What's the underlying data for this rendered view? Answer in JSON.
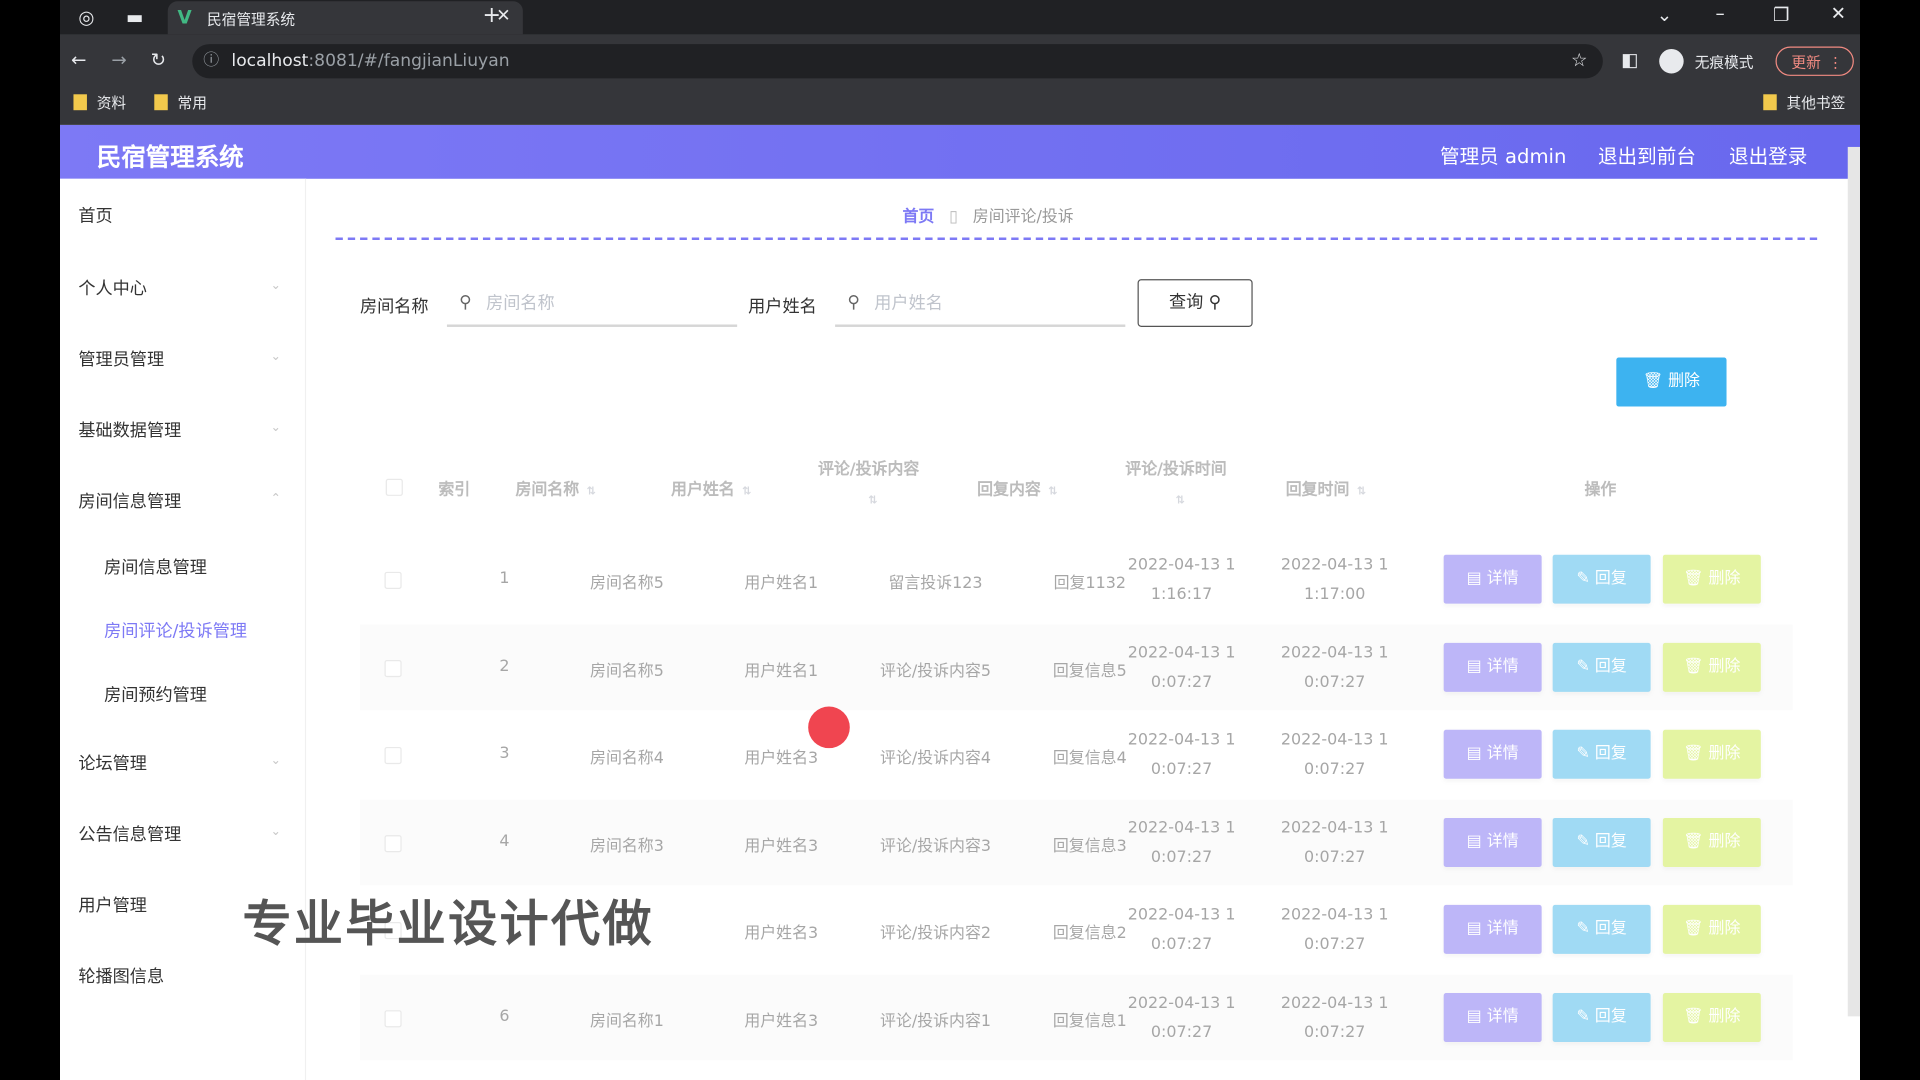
{
  "browser": {
    "tab_title": "民宿管理系统",
    "url_host": "localhost",
    "url_rest": ":8081/#/fangjianLiuyan",
    "profile_label": "无痕模式",
    "update_label": "更新",
    "bookmarks": [
      "资料",
      "常用"
    ],
    "other_bookmarks": "其他书签"
  },
  "header": {
    "title": "民宿管理系统",
    "admin_label": "管理员 admin",
    "to_front": "退出到前台",
    "logout": "退出登录"
  },
  "sidebar": {
    "items": [
      "首页",
      "个人中心",
      "管理员管理",
      "基础数据管理",
      "房间信息管理"
    ],
    "sub_items": [
      "房间信息管理",
      "房间评论/投诉管理",
      "房间预约管理"
    ],
    "items2": [
      "论坛管理",
      "公告信息管理",
      "用户管理",
      "轮播图信息"
    ]
  },
  "breadcrumb": {
    "home": "首页",
    "current": "房间评论/投诉"
  },
  "search": {
    "room_label": "房间名称",
    "room_placeholder": "房间名称",
    "user_label": "用户姓名",
    "user_placeholder": "用户姓名",
    "query_label": "查询"
  },
  "toolbar": {
    "delete_label": "删除"
  },
  "table": {
    "headers": [
      "索引",
      "房间名称",
      "用户姓名",
      "评论/投诉内容",
      "回复内容",
      "评论/投诉时间",
      "回复时间",
      "操作"
    ],
    "rows": [
      {
        "index": "1",
        "room": "房间名称5",
        "user": "用户姓名1",
        "content": "留言投诉123",
        "reply": "回复1132",
        "time1": "2022-04-13 1",
        "time2": "1:16:17",
        "rtime1": "2022-04-13 1",
        "rtime2": "1:17:00"
      },
      {
        "index": "2",
        "room": "房间名称5",
        "user": "用户姓名1",
        "content": "评论/投诉内容5",
        "reply": "回复信息5",
        "time1": "2022-04-13 1",
        "time2": "0:07:27",
        "rtime1": "2022-04-13 1",
        "rtime2": "0:07:27"
      },
      {
        "index": "3",
        "room": "房间名称4",
        "user": "用户姓名3",
        "content": "评论/投诉内容4",
        "reply": "回复信息4",
        "time1": "2022-04-13 1",
        "time2": "0:07:27",
        "rtime1": "2022-04-13 1",
        "rtime2": "0:07:27"
      },
      {
        "index": "4",
        "room": "房间名称3",
        "user": "用户姓名3",
        "content": "评论/投诉内容3",
        "reply": "回复信息3",
        "time1": "2022-04-13 1",
        "time2": "0:07:27",
        "rtime1": "2022-04-13 1",
        "rtime2": "0:07:27"
      },
      {
        "index": "",
        "room": "",
        "user": "用户姓名3",
        "content": "评论/投诉内容2",
        "reply": "回复信息2",
        "time1": "2022-04-13 1",
        "time2": "0:07:27",
        "rtime1": "2022-04-13 1",
        "rtime2": "0:07:27"
      },
      {
        "index": "6",
        "room": "房间名称1",
        "user": "用户姓名3",
        "content": "评论/投诉内容1",
        "reply": "回复信息1",
        "time1": "2022-04-13 1",
        "time2": "0:07:27",
        "rtime1": "2022-04-13 1",
        "rtime2": "0:07:27"
      }
    ],
    "action_detail": "详情",
    "action_reply": "回复",
    "action_delete": "删除"
  },
  "overlay_text": "专业毕业设计代做"
}
